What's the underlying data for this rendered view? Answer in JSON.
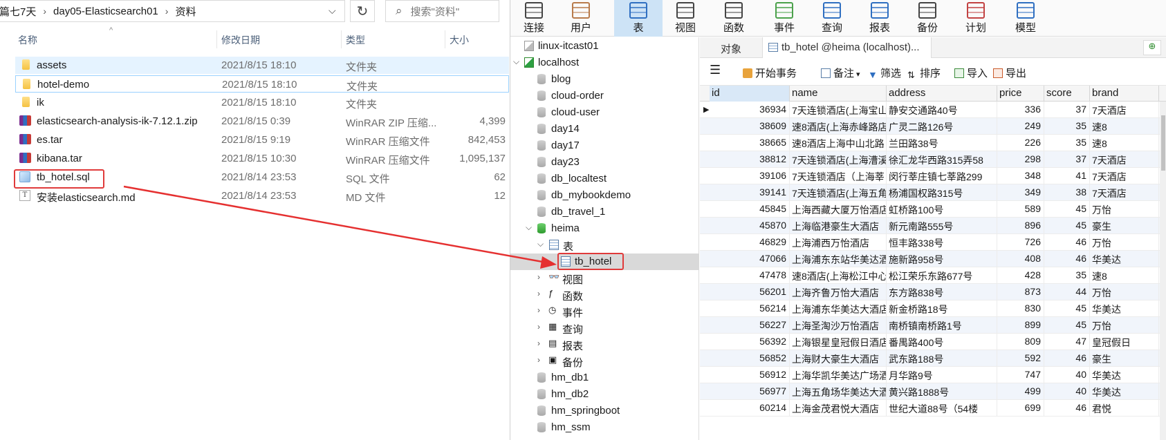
{
  "explorer": {
    "breadcrumb": [
      "篇七7天",
      "day05-Elasticsearch01",
      "资料"
    ],
    "search_placeholder": "搜索\"资料\"",
    "columns": {
      "name": "名称",
      "date": "修改日期",
      "type": "类型",
      "size": "大小"
    },
    "files": [
      {
        "name": "assets",
        "date": "2021/8/15 18:10",
        "type": "文件夹",
        "size": "",
        "icon": "folder-icon"
      },
      {
        "name": "hotel-demo",
        "date": "2021/8/15 18:10",
        "type": "文件夹",
        "size": "",
        "icon": "folder-icon"
      },
      {
        "name": "ik",
        "date": "2021/8/15 18:10",
        "type": "文件夹",
        "size": "",
        "icon": "folder-icon"
      },
      {
        "name": "elasticsearch-analysis-ik-7.12.1.zip",
        "date": "2021/8/15 0:39",
        "type": "WinRAR ZIP 压缩...",
        "size": "4,399",
        "icon": "winrar-icon"
      },
      {
        "name": "es.tar",
        "date": "2021/8/15 9:19",
        "type": "WinRAR 压缩文件",
        "size": "842,453",
        "icon": "winrar-icon"
      },
      {
        "name": "kibana.tar",
        "date": "2021/8/15 10:30",
        "type": "WinRAR 压缩文件",
        "size": "1,095,137",
        "icon": "winrar-icon"
      },
      {
        "name": "tb_hotel.sql",
        "date": "2021/8/14 23:53",
        "type": "SQL 文件",
        "size": "62",
        "icon": "sql-file-icon"
      },
      {
        "name": "安装elasticsearch.md",
        "date": "2021/8/14 23:53",
        "type": "MD 文件",
        "size": "12",
        "icon": "md-file-icon"
      }
    ]
  },
  "navicat": {
    "toolbar": [
      {
        "label": "连接",
        "icon": "plug-icon"
      },
      {
        "label": "用户",
        "icon": "user-icon"
      },
      {
        "label": "表",
        "icon": "table-icon",
        "active": true
      },
      {
        "label": "视图",
        "icon": "glasses-icon"
      },
      {
        "label": "函数",
        "icon": "function-icon"
      },
      {
        "label": "事件",
        "icon": "event-icon"
      },
      {
        "label": "查询",
        "icon": "query-icon"
      },
      {
        "label": "报表",
        "icon": "report-icon"
      },
      {
        "label": "备份",
        "icon": "backup-icon"
      },
      {
        "label": "计划",
        "icon": "schedule-icon"
      },
      {
        "label": "模型",
        "icon": "model-icon"
      }
    ],
    "tree": {
      "connections": [
        "linux-itcast01",
        "localhost"
      ],
      "databases_before": [
        "blog",
        "cloud-order",
        "cloud-user",
        "day14",
        "day17",
        "day23",
        "db_localtest",
        "db_mybookdemo",
        "db_travel_1"
      ],
      "open_db": "heima",
      "tables_folder": "表",
      "selected_table": "tb_hotel",
      "folders": [
        "视图",
        "函数",
        "事件",
        "查询",
        "报表",
        "备份"
      ],
      "databases_after": [
        "hm_db1",
        "hm_db2",
        "hm_springboot",
        "hm_ssm"
      ]
    },
    "tabs": {
      "objects": "对象",
      "active": "tb_hotel @heima (localhost)..."
    },
    "subtoolbar": {
      "begin_txn": "开始事务",
      "note": "备注",
      "filter": "筛选",
      "sort": "排序",
      "import": "导入",
      "export": "导出"
    },
    "grid": {
      "columns": [
        "id",
        "name",
        "address",
        "price",
        "score",
        "brand"
      ],
      "rows": [
        [
          "36934",
          "7天连锁酒店(上海宝山",
          "静安交通路40号",
          "336",
          "37",
          "7天酒店"
        ],
        [
          "38609",
          "速8酒店(上海赤峰路店",
          "广灵二路126号",
          "249",
          "35",
          "速8"
        ],
        [
          "38665",
          "速8酒店上海中山北路",
          "兰田路38号",
          "226",
          "35",
          "速8"
        ],
        [
          "38812",
          "7天连锁酒店(上海漕溪",
          "徐汇龙华西路315弄58",
          "298",
          "37",
          "7天酒店"
        ],
        [
          "39106",
          "7天连锁酒店（上海莘",
          "闵行莘庄镇七莘路299",
          "348",
          "41",
          "7天酒店"
        ],
        [
          "39141",
          "7天连锁酒店(上海五角",
          "杨浦国权路315号",
          "349",
          "38",
          "7天酒店"
        ],
        [
          "45845",
          "上海西藏大厦万怡酒店",
          "虹桥路100号",
          "589",
          "45",
          "万怡"
        ],
        [
          "45870",
          "上海临港豪生大酒店",
          "新元南路555号",
          "896",
          "45",
          "豪生"
        ],
        [
          "46829",
          "上海浦西万怡酒店",
          "恒丰路338号",
          "726",
          "46",
          "万怡"
        ],
        [
          "47066",
          "上海浦东东站华美达酒",
          "施新路958号",
          "408",
          "46",
          "华美达"
        ],
        [
          "47478",
          "速8酒店(上海松江中心",
          "松江荣乐东路677号",
          "428",
          "35",
          "速8"
        ],
        [
          "56201",
          "上海齐鲁万怡大酒店",
          "东方路838号",
          "873",
          "44",
          "万怡"
        ],
        [
          "56214",
          "上海浦东华美达大酒店",
          "新金桥路18号",
          "830",
          "45",
          "华美达"
        ],
        [
          "56227",
          "上海圣淘沙万怡酒店",
          "南桥镇南桥路1号",
          "899",
          "45",
          "万怡"
        ],
        [
          "56392",
          "上海银星皇冠假日酒店",
          "番禺路400号",
          "809",
          "47",
          "皇冠假日"
        ],
        [
          "56852",
          "上海财大豪生大酒店",
          "武东路188号",
          "592",
          "46",
          "豪生"
        ],
        [
          "56912",
          "上海华凯华美达广场酒",
          "月华路9号",
          "747",
          "40",
          "华美达"
        ],
        [
          "56977",
          "上海五角场华美达大酒",
          "黄兴路1888号",
          "499",
          "40",
          "华美达"
        ],
        [
          "60214",
          "上海金茂君悦大酒店",
          "世纪大道88号（54楼",
          "699",
          "46",
          "君悦"
        ]
      ]
    }
  }
}
